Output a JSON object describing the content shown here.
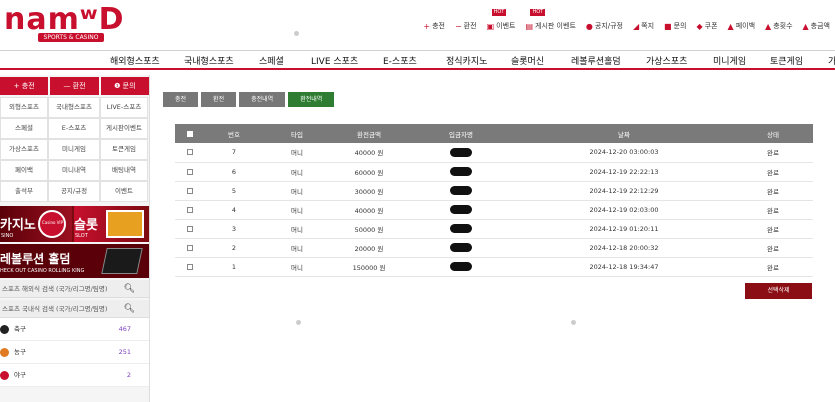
{
  "header": {
    "logo_text": "namʷD",
    "logo_sub": "SPORTS & CASINO",
    "links": [
      {
        "icon": "plus-icon",
        "label": "충전",
        "hot": false
      },
      {
        "icon": "minus-icon",
        "label": "환전",
        "hot": false
      },
      {
        "icon": "gift-icon",
        "label": "이벤트",
        "hot": true
      },
      {
        "icon": "board-icon",
        "label": "게시판 이벤트",
        "hot": true
      },
      {
        "icon": "alert-icon",
        "label": "공지/규정",
        "hot": false
      },
      {
        "icon": "send-icon",
        "label": "쪽지",
        "hot": false
      },
      {
        "icon": "question-icon",
        "label": "문의",
        "hot": false
      },
      {
        "icon": "coupon-icon",
        "label": "쿠폰",
        "hot": false
      },
      {
        "icon": "payback-icon",
        "label": "페이백",
        "hot": false
      },
      {
        "icon": "money-icon",
        "label": "충횟수",
        "hot": false
      },
      {
        "icon": "money2-icon",
        "label": "충금액",
        "hot": false
      }
    ],
    "hot_label": "HOT"
  },
  "nav": [
    "해외형스포츠",
    "국내형스포츠",
    "스페셜",
    "LIVE 스포츠",
    "E-스포츠",
    "정식카지노",
    "슬롯머신",
    "레볼루션홀덤",
    "가상스포츠",
    "미니게임",
    "토큰게임",
    "가"
  ],
  "sidebar": {
    "buttons": [
      "+ 충전",
      "— 환전",
      "❶ 문의"
    ],
    "grid": [
      "외형스포츠",
      "국내형스포츠",
      "LIVE-스포츠",
      "스페셜",
      "E-스포츠",
      "게시판이벤트",
      "가상스포츠",
      "미니게임",
      "토큰게임",
      "페이백",
      "미니내역",
      "배팅내역",
      "출석부",
      "공지/규정",
      "이벤트"
    ],
    "banner1": {
      "left_title": "카지노",
      "left_sub": "SINO",
      "right_title": "슬롯",
      "right_sub": "SLOT",
      "chip": "Casino VIP"
    },
    "banner2": {
      "title": "레볼루션 홀덤",
      "sub": "HECK OUT CASINO ROLLING KING"
    },
    "searches": [
      "스포츠 해외식 검색 (국가/리그명/팀명)",
      "스포츠 국내식 검색 (국가/리그명/팀명)"
    ],
    "sports": [
      {
        "name": "축구",
        "count": "467",
        "color": "#222"
      },
      {
        "name": "농구",
        "count": "251",
        "color": "#e07b22"
      },
      {
        "name": "야구",
        "count": "2",
        "color": "#c8102e"
      }
    ]
  },
  "content": {
    "tabs": [
      "충전",
      "환전",
      "충전내역",
      "환전내역"
    ],
    "active_tab": 3,
    "columns": [
      "■",
      "번호",
      "타입",
      "환전금액",
      "입금자명",
      "날짜",
      "상태"
    ],
    "rows": [
      {
        "no": "7",
        "type": "머니",
        "amount": "40000 원",
        "date": "2024-12-20 03:00:03",
        "status": "완료"
      },
      {
        "no": "6",
        "type": "머니",
        "amount": "60000 원",
        "date": "2024-12-19 22:22:13",
        "status": "완료"
      },
      {
        "no": "5",
        "type": "머니",
        "amount": "30000 원",
        "date": "2024-12-19 22:12:29",
        "status": "완료"
      },
      {
        "no": "4",
        "type": "머니",
        "amount": "40000 원",
        "date": "2024-12-19 02:03:00",
        "status": "완료"
      },
      {
        "no": "3",
        "type": "머니",
        "amount": "50000 원",
        "date": "2024-12-19 01:20:11",
        "status": "완료"
      },
      {
        "no": "2",
        "type": "머니",
        "amount": "20000 원",
        "date": "2024-12-18 20:00:32",
        "status": "완료"
      },
      {
        "no": "1",
        "type": "머니",
        "amount": "150000 원",
        "date": "2024-12-18 19:34:47",
        "status": "완료"
      }
    ],
    "delete_label": "선택삭제"
  },
  "colors": {
    "brand": "#c8102e",
    "active_tab": "#2e7d32",
    "header_gray": "#7a7a7a",
    "count_purple": "#7a3fbf"
  }
}
